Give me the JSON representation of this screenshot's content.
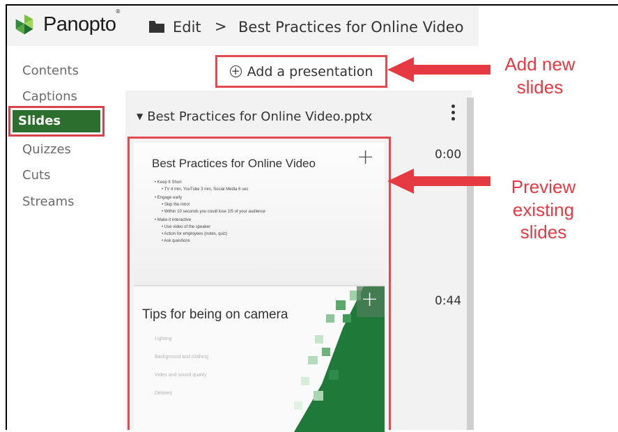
{
  "header": {
    "logo_text": "Panopto",
    "logo_trademark": "®",
    "breadcrumb_edit": "Edit",
    "breadcrumb_separator": ">",
    "breadcrumb_title": "Best Practices for Online Video"
  },
  "sidebar": {
    "items": [
      "Contents",
      "Captions",
      "Slides",
      "Quizzes",
      "Cuts",
      "Streams"
    ],
    "active": "Slides"
  },
  "add_presentation": {
    "label": "Add a presentation"
  },
  "presentation": {
    "filename": "Best Practices for Online Video.pptx",
    "slides": [
      {
        "time": "0:00",
        "title": "Best Practices for Online Video",
        "bullets": [
          "• Keep It Short",
          "• TV 4 min, YouTube 3 min, Social Media 6 sec",
          "• Engage early",
          "• Skip the intro!",
          "• Within 10 seconds you could lose 1/5 of your audience",
          "• Make it interactive",
          "• Use video of the speaker",
          "• Action for employees (notes, quiz)",
          "• Ask questions"
        ]
      },
      {
        "time": "0:44",
        "title": "Tips for being on camera",
        "bullets": [
          "Lighting",
          "Background and clothing",
          "Video and sound quality",
          "Delivery"
        ]
      }
    ]
  },
  "annotations": {
    "add_new_slides": [
      "Add new",
      "slides"
    ],
    "preview_existing_slides": [
      "Preview",
      "existing",
      "slides"
    ]
  },
  "colors": {
    "annotation_red": "#e63a43",
    "active_green": "#2b6e2e",
    "slide_green": "#1f7a3a"
  }
}
